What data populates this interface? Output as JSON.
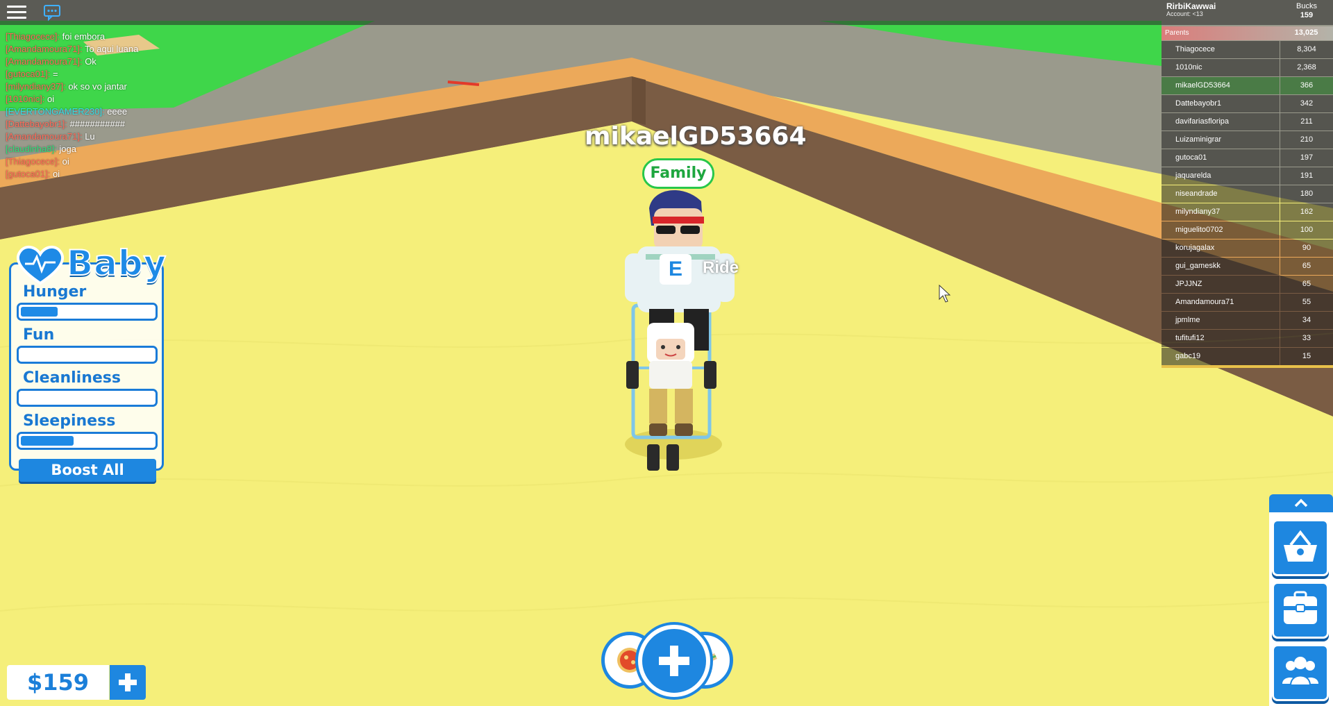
{
  "topbar": {
    "account_name": "RirbiKawwai",
    "account_sub": "Account: <13",
    "bucks_label": "Bucks",
    "bucks_value": "159",
    "menu_icon": "hamburger-menu-icon",
    "chat_icon": "chat-bubble-icon"
  },
  "chat": {
    "lines": [
      {
        "name": "[Thiagocece]:",
        "msg": " foi embora",
        "color": "#ff6a5a"
      },
      {
        "name": "[Amandamoura71]:",
        "msg": " To aqui luana",
        "color": "#ff6a5a"
      },
      {
        "name": "[Amandamoura71]:",
        "msg": " Ok",
        "color": "#ff6a5a"
      },
      {
        "name": "[gutoca01]:",
        "msg": " =",
        "color": "#ff6a5a"
      },
      {
        "name": "[milyndiany37]:",
        "msg": " ok so vo jantar",
        "color": "#ff6a5a"
      },
      {
        "name": "[1010nic]:",
        "msg": " oi",
        "color": "#ff6a5a"
      },
      {
        "name": "[EVERTONGAMER230]:",
        "msg": " eeee",
        "color": "#33e0e6"
      },
      {
        "name": "[Dattebayobr1]:",
        "msg": " ###########",
        "color": "#ff6a5a"
      },
      {
        "name": "[Amandamoura71]:",
        "msg": " Lu",
        "color": "#ff6a5a"
      },
      {
        "name": "[claudinha8]:",
        "msg": " joga",
        "color": "#2fe07a"
      },
      {
        "name": "[Thiagocece]:",
        "msg": " oi",
        "color": "#ff6a5a"
      },
      {
        "name": "[gutoca01]:",
        "msg": " oi",
        "color": "#ff6a5a"
      }
    ]
  },
  "leaderboard": {
    "team_name": "Parents",
    "team_total": "13,025",
    "rows": [
      {
        "name": "Thiagocece",
        "value": "8,304"
      },
      {
        "name": "1010nic",
        "value": "2,368"
      },
      {
        "name": "mikaelGD53664",
        "value": "366"
      },
      {
        "name": "Dattebayobr1",
        "value": "342"
      },
      {
        "name": "davifariasfloripa",
        "value": "211"
      },
      {
        "name": "Luizaminigrar",
        "value": "210"
      },
      {
        "name": "gutoca01",
        "value": "197"
      },
      {
        "name": "jaquarelda",
        "value": "191"
      },
      {
        "name": "niseandrade",
        "value": "180"
      },
      {
        "name": "milyndiany37",
        "value": "162"
      },
      {
        "name": "miguelito0702",
        "value": "100"
      },
      {
        "name": "korujagalax",
        "value": "90"
      },
      {
        "name": "gui_gameskk",
        "value": "65"
      },
      {
        "name": "JPJJNZ",
        "value": "65"
      },
      {
        "name": "Amandamoura71",
        "value": "55"
      },
      {
        "name": "jpmlme",
        "value": "34"
      },
      {
        "name": "tufitufi12",
        "value": "33"
      },
      {
        "name": "gabc19",
        "value": "15"
      }
    ]
  },
  "baby_panel": {
    "title": "Baby",
    "logo_icon": "heart-pulse-icon",
    "stats": [
      {
        "label": "Hunger",
        "level": 0.28
      },
      {
        "label": "Fun",
        "level": 0.0
      },
      {
        "label": "Cleanliness",
        "level": 0.0
      },
      {
        "label": "Sleepiness",
        "level": 0.4
      }
    ],
    "boost_label": "Boost All"
  },
  "player": {
    "name": "mikaelGD53664",
    "team_tag": "Family",
    "interact_key": "E",
    "interact_label": "Ride"
  },
  "money": {
    "amount": "$159",
    "add_icon": "plus-icon"
  },
  "actions": {
    "main_icon": "plus-icon",
    "left_icon": "pizza-food-icon",
    "right_icon": "sandwich-food-icon"
  },
  "side_buttons": {
    "toggle_icon": "chevron-up-icon",
    "shop_icon": "shopping-basket-icon",
    "backpack_icon": "backpack-icon",
    "family_icon": "people-group-icon"
  },
  "colors": {
    "accent": "#1e87e0",
    "family_green": "#28c74a",
    "ground": "#f5ef7a"
  }
}
